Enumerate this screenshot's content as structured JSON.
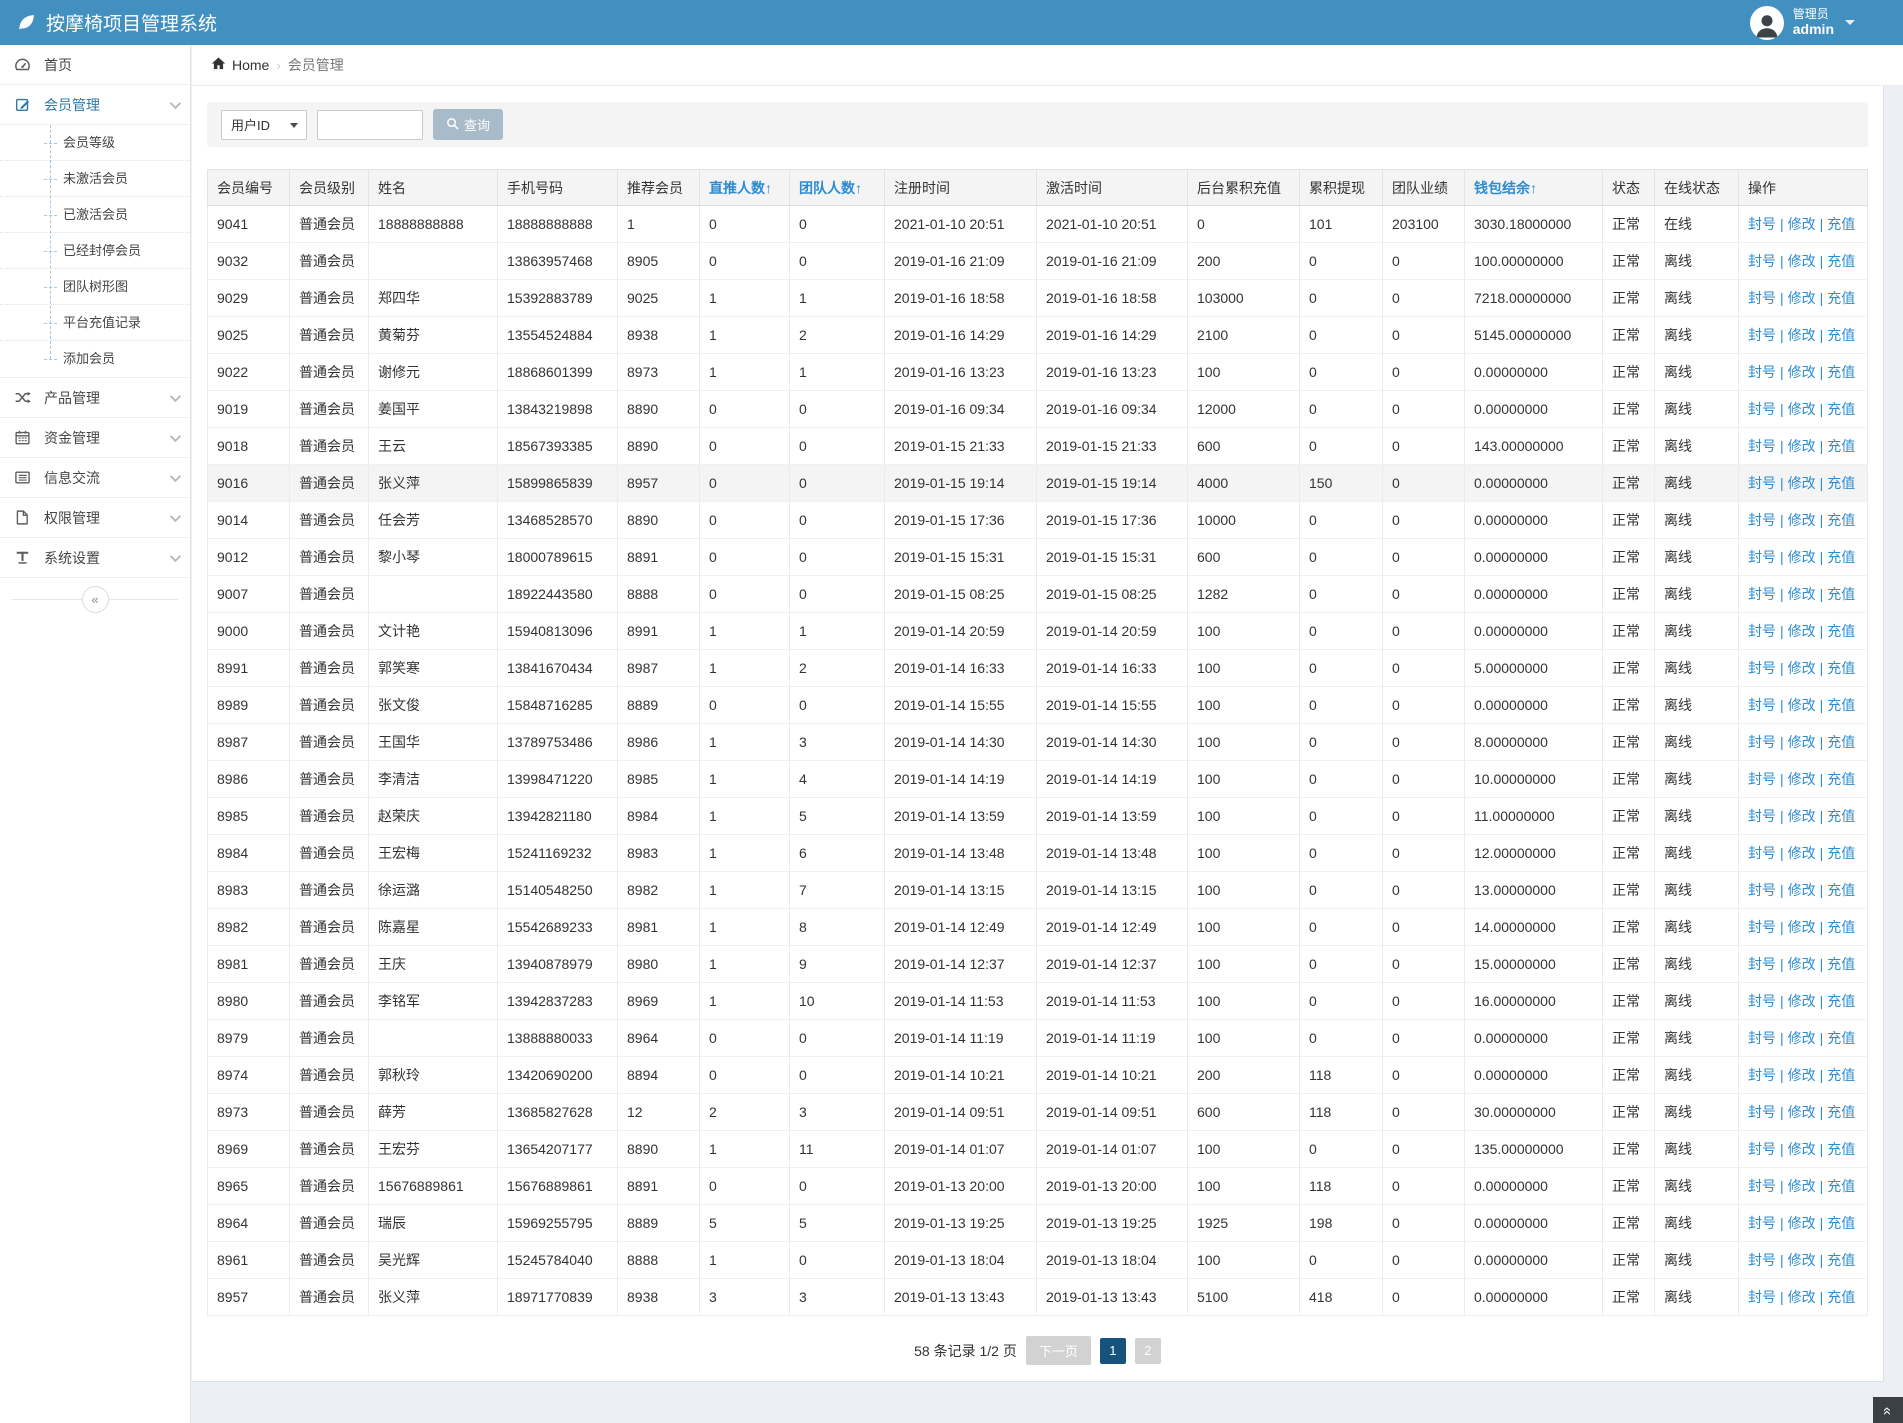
{
  "app": {
    "title": "按摩椅项目管理系统",
    "logo_icon": "leaf-icon"
  },
  "user": {
    "role": "管理员",
    "name": "admin"
  },
  "sidebar": {
    "items": [
      {
        "label": "首页",
        "icon": "dashboard-icon"
      },
      {
        "label": "会员管理",
        "icon": "edit-icon",
        "expanded": true,
        "children": [
          "会员等级",
          "未激活会员",
          "已激活会员",
          "已经封停会员",
          "团队树形图",
          "平台充值记录",
          "添加会员"
        ]
      },
      {
        "label": "产品管理",
        "icon": "shuffle-icon"
      },
      {
        "label": "资金管理",
        "icon": "calendar-icon"
      },
      {
        "label": "信息交流",
        "icon": "list-icon"
      },
      {
        "label": "权限管理",
        "icon": "file-icon"
      },
      {
        "label": "系统设置",
        "icon": "text-icon"
      }
    ],
    "collapse_icon": "collapse-left-icon"
  },
  "breadcrumb": {
    "home": "Home",
    "separator": "›",
    "current": "会员管理"
  },
  "search": {
    "field_selected": "用户ID",
    "query_value": "",
    "button_label": "查询",
    "button_icon": "search-icon"
  },
  "table": {
    "sort_indicator": "↑",
    "columns": [
      {
        "key": "id",
        "label": "会员编号",
        "type": "link",
        "sorted": false
      },
      {
        "key": "level",
        "label": "会员级别",
        "sorted": false
      },
      {
        "key": "name",
        "label": "姓名",
        "sorted": false
      },
      {
        "key": "phone",
        "label": "手机号码",
        "sorted": false
      },
      {
        "key": "referrer",
        "label": "推荐会员",
        "type": "link",
        "sorted": false
      },
      {
        "key": "direct",
        "label": "直推人数",
        "type": "link",
        "sorted": true
      },
      {
        "key": "team",
        "label": "团队人数",
        "sorted": true
      },
      {
        "key": "reg_time",
        "label": "注册时间",
        "sorted": false
      },
      {
        "key": "act_time",
        "label": "激活时间",
        "sorted": false
      },
      {
        "key": "recharge",
        "label": "后台累积充值",
        "sorted": false
      },
      {
        "key": "withdraw",
        "label": "累积提现",
        "sorted": false
      },
      {
        "key": "team_perf",
        "label": "团队业绩",
        "sorted": false
      },
      {
        "key": "wallet",
        "label": "钱包结余",
        "sorted": true
      },
      {
        "key": "status",
        "label": "状态",
        "sorted": false
      },
      {
        "key": "online",
        "label": "在线状态",
        "type": "online",
        "sorted": false
      },
      {
        "key": "ops",
        "label": "操作",
        "type": "ops",
        "sorted": false
      }
    ],
    "ops": [
      "封号",
      "修改",
      "充值"
    ],
    "ops_separator": "|",
    "rows": [
      {
        "id": "9041",
        "level": "普通会员",
        "name": "18888888888",
        "phone": "18888888888",
        "referrer": "1",
        "direct": "0",
        "team": "0",
        "reg_time": "2021-01-10 20:51",
        "act_time": "2021-01-10 20:51",
        "recharge": "0",
        "withdraw": "101",
        "team_perf": "203100",
        "wallet": "3030.18000000",
        "status": "正常",
        "online": "在线",
        "highlighted": false
      },
      {
        "id": "9032",
        "level": "普通会员",
        "name": "",
        "phone": "13863957468",
        "referrer": "8905",
        "direct": "0",
        "team": "0",
        "reg_time": "2019-01-16 21:09",
        "act_time": "2019-01-16 21:09",
        "recharge": "200",
        "withdraw": "0",
        "team_perf": "0",
        "wallet": "100.00000000",
        "status": "正常",
        "online": "离线",
        "highlighted": false
      },
      {
        "id": "9029",
        "level": "普通会员",
        "name": "郑四华",
        "phone": "15392883789",
        "referrer": "9025",
        "direct": "1",
        "team": "1",
        "reg_time": "2019-01-16 18:58",
        "act_time": "2019-01-16 18:58",
        "recharge": "103000",
        "withdraw": "0",
        "team_perf": "0",
        "wallet": "7218.00000000",
        "status": "正常",
        "online": "离线",
        "highlighted": false
      },
      {
        "id": "9025",
        "level": "普通会员",
        "name": "黄菊芬",
        "phone": "13554524884",
        "referrer": "8938",
        "direct": "1",
        "team": "2",
        "reg_time": "2019-01-16 14:29",
        "act_time": "2019-01-16 14:29",
        "recharge": "2100",
        "withdraw": "0",
        "team_perf": "0",
        "wallet": "5145.00000000",
        "status": "正常",
        "online": "离线",
        "highlighted": false
      },
      {
        "id": "9022",
        "level": "普通会员",
        "name": "谢修元",
        "phone": "18868601399",
        "referrer": "8973",
        "direct": "1",
        "team": "1",
        "reg_time": "2019-01-16 13:23",
        "act_time": "2019-01-16 13:23",
        "recharge": "100",
        "withdraw": "0",
        "team_perf": "0",
        "wallet": "0.00000000",
        "status": "正常",
        "online": "离线",
        "highlighted": false
      },
      {
        "id": "9019",
        "level": "普通会员",
        "name": "姜国平",
        "phone": "13843219898",
        "referrer": "8890",
        "direct": "0",
        "team": "0",
        "reg_time": "2019-01-16 09:34",
        "act_time": "2019-01-16 09:34",
        "recharge": "12000",
        "withdraw": "0",
        "team_perf": "0",
        "wallet": "0.00000000",
        "status": "正常",
        "online": "离线",
        "highlighted": false
      },
      {
        "id": "9018",
        "level": "普通会员",
        "name": "王云",
        "phone": "18567393385",
        "referrer": "8890",
        "direct": "0",
        "team": "0",
        "reg_time": "2019-01-15 21:33",
        "act_time": "2019-01-15 21:33",
        "recharge": "600",
        "withdraw": "0",
        "team_perf": "0",
        "wallet": "143.00000000",
        "status": "正常",
        "online": "离线",
        "highlighted": false
      },
      {
        "id": "9016",
        "level": "普通会员",
        "name": "张义萍",
        "phone": "15899865839",
        "referrer": "8957",
        "direct": "0",
        "team": "0",
        "reg_time": "2019-01-15 19:14",
        "act_time": "2019-01-15 19:14",
        "recharge": "4000",
        "withdraw": "150",
        "team_perf": "0",
        "wallet": "0.00000000",
        "status": "正常",
        "online": "离线",
        "highlighted": true
      },
      {
        "id": "9014",
        "level": "普通会员",
        "name": "任会芳",
        "phone": "13468528570",
        "referrer": "8890",
        "direct": "0",
        "team": "0",
        "reg_time": "2019-01-15 17:36",
        "act_time": "2019-01-15 17:36",
        "recharge": "10000",
        "withdraw": "0",
        "team_perf": "0",
        "wallet": "0.00000000",
        "status": "正常",
        "online": "离线",
        "highlighted": false
      },
      {
        "id": "9012",
        "level": "普通会员",
        "name": "黎小琴",
        "phone": "18000789615",
        "referrer": "8891",
        "direct": "0",
        "team": "0",
        "reg_time": "2019-01-15 15:31",
        "act_time": "2019-01-15 15:31",
        "recharge": "600",
        "withdraw": "0",
        "team_perf": "0",
        "wallet": "0.00000000",
        "status": "正常",
        "online": "离线",
        "highlighted": false
      },
      {
        "id": "9007",
        "level": "普通会员",
        "name": "",
        "phone": "18922443580",
        "referrer": "8888",
        "direct": "0",
        "team": "0",
        "reg_time": "2019-01-15 08:25",
        "act_time": "2019-01-15 08:25",
        "recharge": "1282",
        "withdraw": "0",
        "team_perf": "0",
        "wallet": "0.00000000",
        "status": "正常",
        "online": "离线",
        "highlighted": false
      },
      {
        "id": "9000",
        "level": "普通会员",
        "name": "文计艳",
        "phone": "15940813096",
        "referrer": "8991",
        "direct": "1",
        "team": "1",
        "reg_time": "2019-01-14 20:59",
        "act_time": "2019-01-14 20:59",
        "recharge": "100",
        "withdraw": "0",
        "team_perf": "0",
        "wallet": "0.00000000",
        "status": "正常",
        "online": "离线",
        "highlighted": false
      },
      {
        "id": "8991",
        "level": "普通会员",
        "name": "郭笑寒",
        "phone": "13841670434",
        "referrer": "8987",
        "direct": "1",
        "team": "2",
        "reg_time": "2019-01-14 16:33",
        "act_time": "2019-01-14 16:33",
        "recharge": "100",
        "withdraw": "0",
        "team_perf": "0",
        "wallet": "5.00000000",
        "status": "正常",
        "online": "离线",
        "highlighted": false
      },
      {
        "id": "8989",
        "level": "普通会员",
        "name": "张文俊",
        "phone": "15848716285",
        "referrer": "8889",
        "direct": "0",
        "team": "0",
        "reg_time": "2019-01-14 15:55",
        "act_time": "2019-01-14 15:55",
        "recharge": "100",
        "withdraw": "0",
        "team_perf": "0",
        "wallet": "0.00000000",
        "status": "正常",
        "online": "离线",
        "highlighted": false
      },
      {
        "id": "8987",
        "level": "普通会员",
        "name": "王国华",
        "phone": "13789753486",
        "referrer": "8986",
        "direct": "1",
        "team": "3",
        "reg_time": "2019-01-14 14:30",
        "act_time": "2019-01-14 14:30",
        "recharge": "100",
        "withdraw": "0",
        "team_perf": "0",
        "wallet": "8.00000000",
        "status": "正常",
        "online": "离线",
        "highlighted": false
      },
      {
        "id": "8986",
        "level": "普通会员",
        "name": "李清洁",
        "phone": "13998471220",
        "referrer": "8985",
        "direct": "1",
        "team": "4",
        "reg_time": "2019-01-14 14:19",
        "act_time": "2019-01-14 14:19",
        "recharge": "100",
        "withdraw": "0",
        "team_perf": "0",
        "wallet": "10.00000000",
        "status": "正常",
        "online": "离线",
        "highlighted": false
      },
      {
        "id": "8985",
        "level": "普通会员",
        "name": "赵荣庆",
        "phone": "13942821180",
        "referrer": "8984",
        "direct": "1",
        "team": "5",
        "reg_time": "2019-01-14 13:59",
        "act_time": "2019-01-14 13:59",
        "recharge": "100",
        "withdraw": "0",
        "team_perf": "0",
        "wallet": "11.00000000",
        "status": "正常",
        "online": "离线",
        "highlighted": false
      },
      {
        "id": "8984",
        "level": "普通会员",
        "name": "王宏梅",
        "phone": "15241169232",
        "referrer": "8983",
        "direct": "1",
        "team": "6",
        "reg_time": "2019-01-14 13:48",
        "act_time": "2019-01-14 13:48",
        "recharge": "100",
        "withdraw": "0",
        "team_perf": "0",
        "wallet": "12.00000000",
        "status": "正常",
        "online": "离线",
        "highlighted": false
      },
      {
        "id": "8983",
        "level": "普通会员",
        "name": "徐运潞",
        "phone": "15140548250",
        "referrer": "8982",
        "direct": "1",
        "team": "7",
        "reg_time": "2019-01-14 13:15",
        "act_time": "2019-01-14 13:15",
        "recharge": "100",
        "withdraw": "0",
        "team_perf": "0",
        "wallet": "13.00000000",
        "status": "正常",
        "online": "离线",
        "highlighted": false
      },
      {
        "id": "8982",
        "level": "普通会员",
        "name": "陈嘉星",
        "phone": "15542689233",
        "referrer": "8981",
        "direct": "1",
        "team": "8",
        "reg_time": "2019-01-14 12:49",
        "act_time": "2019-01-14 12:49",
        "recharge": "100",
        "withdraw": "0",
        "team_perf": "0",
        "wallet": "14.00000000",
        "status": "正常",
        "online": "离线",
        "highlighted": false
      },
      {
        "id": "8981",
        "level": "普通会员",
        "name": "王庆",
        "phone": "13940878979",
        "referrer": "8980",
        "direct": "1",
        "team": "9",
        "reg_time": "2019-01-14 12:37",
        "act_time": "2019-01-14 12:37",
        "recharge": "100",
        "withdraw": "0",
        "team_perf": "0",
        "wallet": "15.00000000",
        "status": "正常",
        "online": "离线",
        "highlighted": false
      },
      {
        "id": "8980",
        "level": "普通会员",
        "name": "李铭军",
        "phone": "13942837283",
        "referrer": "8969",
        "direct": "1",
        "team": "10",
        "reg_time": "2019-01-14 11:53",
        "act_time": "2019-01-14 11:53",
        "recharge": "100",
        "withdraw": "0",
        "team_perf": "0",
        "wallet": "16.00000000",
        "status": "正常",
        "online": "离线",
        "highlighted": false
      },
      {
        "id": "8979",
        "level": "普通会员",
        "name": "",
        "phone": "13888880033",
        "referrer": "8964",
        "direct": "0",
        "team": "0",
        "reg_time": "2019-01-14 11:19",
        "act_time": "2019-01-14 11:19",
        "recharge": "100",
        "withdraw": "0",
        "team_perf": "0",
        "wallet": "0.00000000",
        "status": "正常",
        "online": "离线",
        "highlighted": false
      },
      {
        "id": "8974",
        "level": "普通会员",
        "name": "郭秋玲",
        "phone": "13420690200",
        "referrer": "8894",
        "direct": "0",
        "team": "0",
        "reg_time": "2019-01-14 10:21",
        "act_time": "2019-01-14 10:21",
        "recharge": "200",
        "withdraw": "118",
        "team_perf": "0",
        "wallet": "0.00000000",
        "status": "正常",
        "online": "离线",
        "highlighted": false
      },
      {
        "id": "8973",
        "level": "普通会员",
        "name": "薛芳",
        "phone": "13685827628",
        "referrer": "12",
        "direct": "2",
        "team": "3",
        "reg_time": "2019-01-14 09:51",
        "act_time": "2019-01-14 09:51",
        "recharge": "600",
        "withdraw": "118",
        "team_perf": "0",
        "wallet": "30.00000000",
        "status": "正常",
        "online": "离线",
        "highlighted": false
      },
      {
        "id": "8969",
        "level": "普通会员",
        "name": "王宏芬",
        "phone": "13654207177",
        "referrer": "8890",
        "direct": "1",
        "team": "11",
        "reg_time": "2019-01-14 01:07",
        "act_time": "2019-01-14 01:07",
        "recharge": "100",
        "withdraw": "0",
        "team_perf": "0",
        "wallet": "135.00000000",
        "status": "正常",
        "online": "离线",
        "highlighted": false
      },
      {
        "id": "8965",
        "level": "普通会员",
        "name": "15676889861",
        "phone": "15676889861",
        "referrer": "8891",
        "direct": "0",
        "team": "0",
        "reg_time": "2019-01-13 20:00",
        "act_time": "2019-01-13 20:00",
        "recharge": "100",
        "withdraw": "118",
        "team_perf": "0",
        "wallet": "0.00000000",
        "status": "正常",
        "online": "离线",
        "highlighted": false
      },
      {
        "id": "8964",
        "level": "普通会员",
        "name": "瑞辰",
        "phone": "15969255795",
        "referrer": "8889",
        "direct": "5",
        "team": "5",
        "reg_time": "2019-01-13 19:25",
        "act_time": "2019-01-13 19:25",
        "recharge": "1925",
        "withdraw": "198",
        "team_perf": "0",
        "wallet": "0.00000000",
        "status": "正常",
        "online": "离线",
        "highlighted": false
      },
      {
        "id": "8961",
        "level": "普通会员",
        "name": "吴光辉",
        "phone": "15245784040",
        "referrer": "8888",
        "direct": "1",
        "team": "0",
        "reg_time": "2019-01-13 18:04",
        "act_time": "2019-01-13 18:04",
        "recharge": "100",
        "withdraw": "0",
        "team_perf": "0",
        "wallet": "0.00000000",
        "status": "正常",
        "online": "离线",
        "highlighted": false
      },
      {
        "id": "8957",
        "level": "普通会员",
        "name": "张义萍",
        "phone": "18971770839",
        "referrer": "8938",
        "direct": "3",
        "team": "3",
        "reg_time": "2019-01-13 13:43",
        "act_time": "2019-01-13 13:43",
        "recharge": "5100",
        "withdraw": "418",
        "team_perf": "0",
        "wallet": "0.00000000",
        "status": "正常",
        "online": "离线",
        "highlighted": false
      }
    ]
  },
  "pagination": {
    "summary": "58 条记录 1/2 页",
    "next_label": "下一页",
    "pages": [
      "1",
      "2"
    ],
    "active_page": "1"
  },
  "colors": {
    "navbar": "#4190c0",
    "link": "#2d8cd0",
    "online_red": "#dd3c2a",
    "offline_gray": "#d4d7da",
    "active_page": "#15537e",
    "button": "#a7bbc8"
  }
}
